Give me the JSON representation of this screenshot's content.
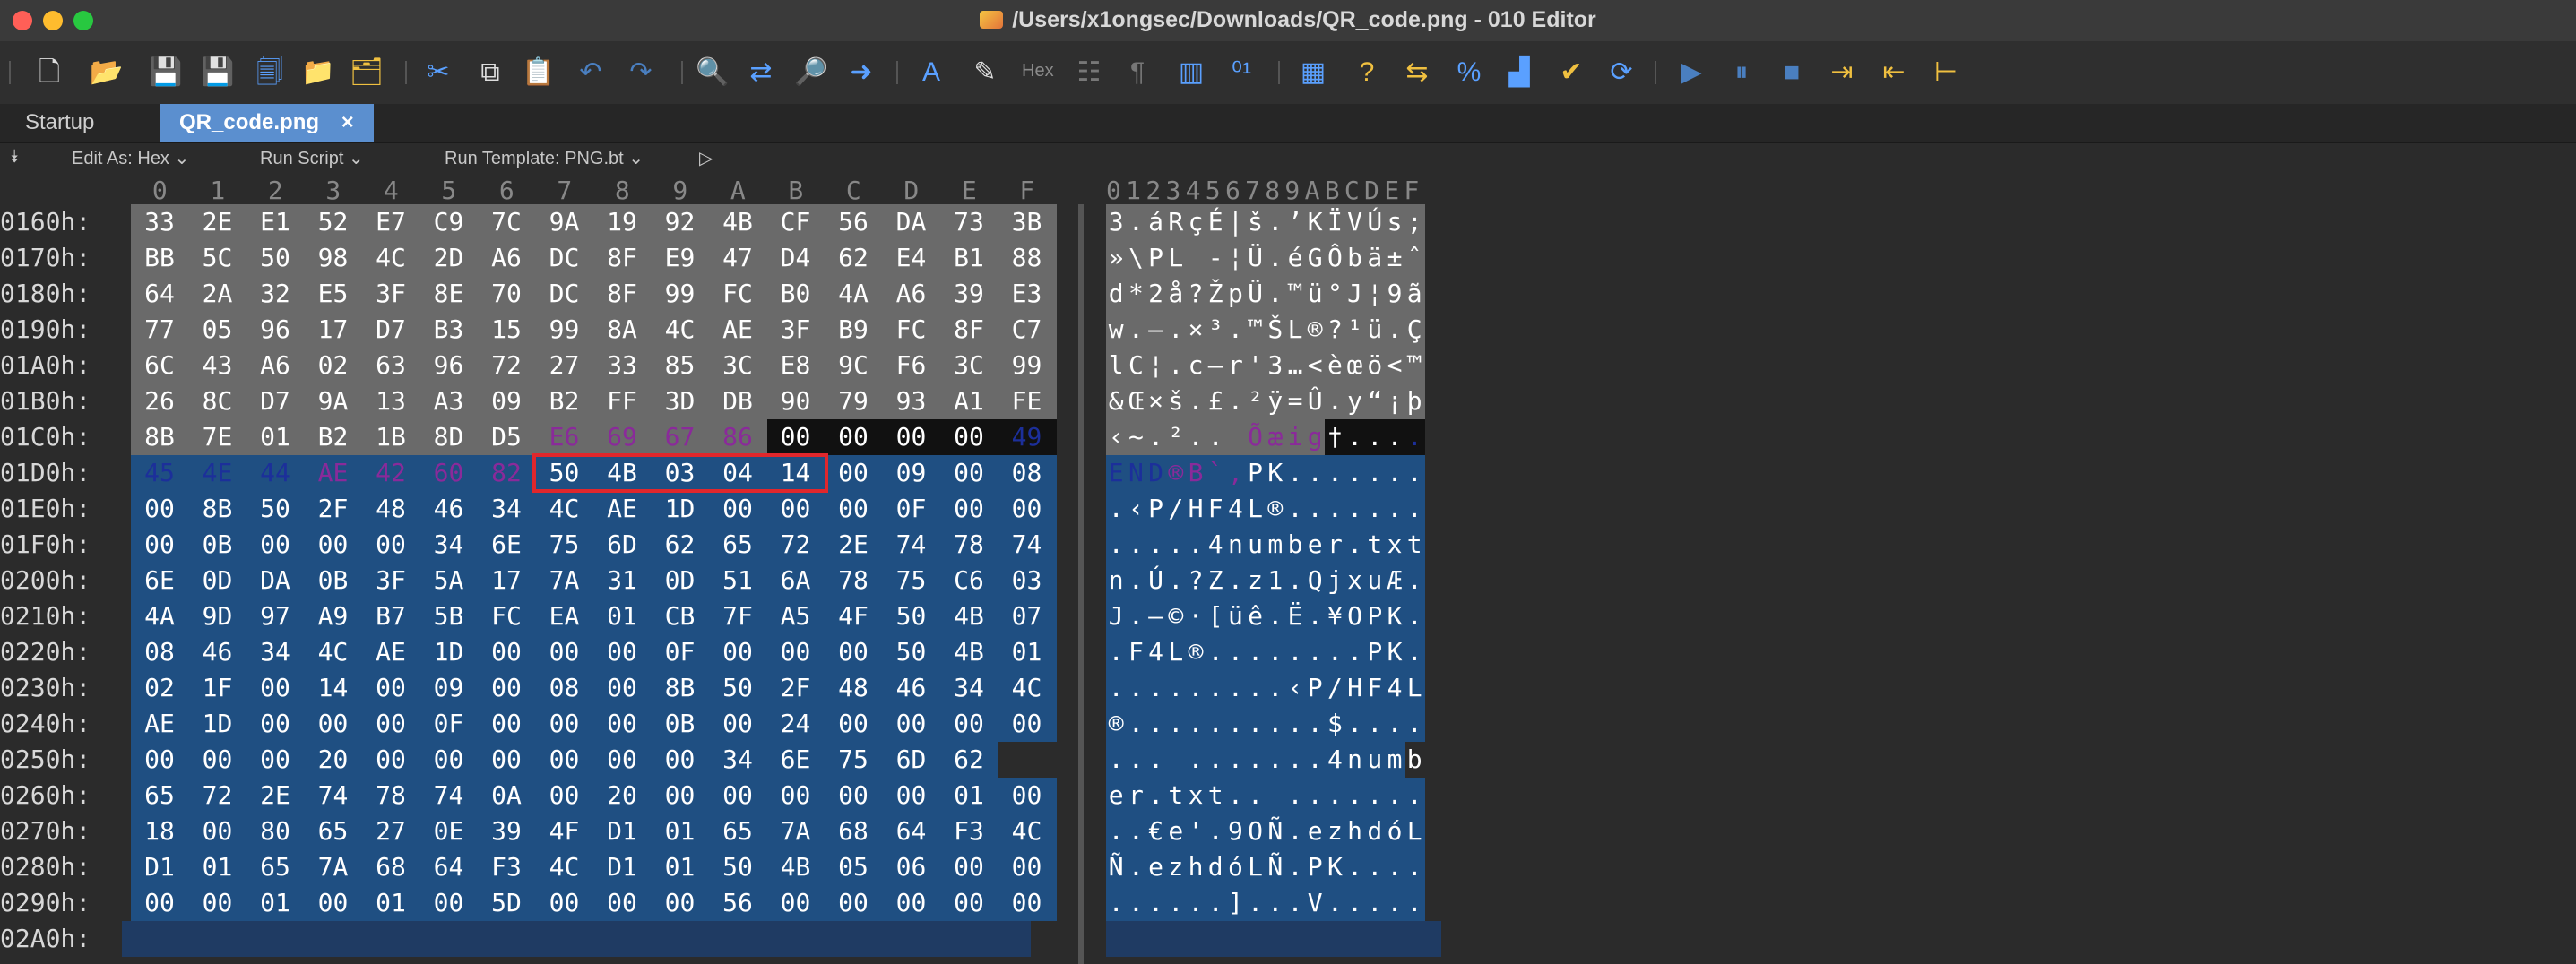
{
  "window": {
    "title": "/Users/x1ongsec/Downloads/QR_code.png - 010 Editor"
  },
  "toolbar": {
    "hex_label": "Hex",
    "icons": [
      "new-file-icon",
      "open-folder-icon",
      "save-icon",
      "save-all-icon",
      "save-copy-icon",
      "open-folder-2-icon",
      "open-workspace-icon",
      "cut-icon",
      "copy-icon",
      "paste-icon",
      "undo-icon",
      "redo-icon",
      "find-icon",
      "replace-icon",
      "find-in-files-icon",
      "goto-icon",
      "font-icon",
      "highlight-icon",
      "hex-mode-icon",
      "columns-icon",
      "pilcrow-icon",
      "grid-icon",
      "binary-icon",
      "calculator-icon",
      "inspector-icon",
      "swap-icon",
      "percent-icon",
      "chart-icon",
      "check-icon",
      "convert-icon",
      "run-icon",
      "pause-icon",
      "stop-icon",
      "indent-icon",
      "outdent-icon",
      "tree-icon"
    ]
  },
  "tabs": [
    {
      "label": "Startup"
    },
    {
      "label": "QR_code.png",
      "close": "×"
    }
  ],
  "editbar": {
    "edit_as": "Edit As: Hex",
    "run_script": "Run Script",
    "run_template": "Run Template: PNG.bt",
    "play": "▷"
  },
  "columns": [
    "0",
    "1",
    "2",
    "3",
    "4",
    "5",
    "6",
    "7",
    "8",
    "9",
    "A",
    "B",
    "C",
    "D",
    "E",
    "F"
  ],
  "ascii_header": "0123456789ABCDEF",
  "colors": {
    "selected_blue": "#1f4f82",
    "gray_region": "#6a6a6a",
    "purple_text": "#8a2a9a",
    "navy_text": "#1c2f9a",
    "black_region": "#111111",
    "red_highlight": "#e0272c"
  },
  "rows": [
    {
      "addr": "0160h:",
      "hex": [
        "33",
        "2E",
        "E1",
        "52",
        "E7",
        "C9",
        "7C",
        "9A",
        "19",
        "92",
        "4B",
        "CF",
        "56",
        "DA",
        "73",
        "3B"
      ],
      "ascii": "3.áRçÉ|š.’KÏVÚs;"
    },
    {
      "addr": "0170h:",
      "hex": [
        "BB",
        "5C",
        "50",
        "98",
        "4C",
        "2D",
        "A6",
        "DC",
        "8F",
        "E9",
        "47",
        "D4",
        "62",
        "E4",
        "B1",
        "88"
      ],
      "ascii": "»\\PL -¦Ü.éGÔbä±ˆ"
    },
    {
      "addr": "0180h:",
      "hex": [
        "64",
        "2A",
        "32",
        "E5",
        "3F",
        "8E",
        "70",
        "DC",
        "8F",
        "99",
        "FC",
        "B0",
        "4A",
        "A6",
        "39",
        "E3"
      ],
      "ascii": "d*2å?ŽpÜ.™ü°J¦9ã"
    },
    {
      "addr": "0190h:",
      "hex": [
        "77",
        "05",
        "96",
        "17",
        "D7",
        "B3",
        "15",
        "99",
        "8A",
        "4C",
        "AE",
        "3F",
        "B9",
        "FC",
        "8F",
        "C7"
      ],
      "ascii": "w.–.×³.™ŠL®?¹ü.Ç"
    },
    {
      "addr": "01A0h:",
      "hex": [
        "6C",
        "43",
        "A6",
        "02",
        "63",
        "96",
        "72",
        "27",
        "33",
        "85",
        "3C",
        "E8",
        "9C",
        "F6",
        "3C",
        "99"
      ],
      "ascii": "lC¦.c–r'3…<èœö<™"
    },
    {
      "addr": "01B0h:",
      "hex": [
        "26",
        "8C",
        "D7",
        "9A",
        "13",
        "A3",
        "09",
        "B2",
        "FF",
        "3D",
        "DB",
        "90",
        "79",
        "93",
        "A1",
        "FE"
      ],
      "ascii": "&Œ×š.£.²ÿ=Û.y“¡þ"
    },
    {
      "addr": "01C0h:",
      "hex": [
        "8B",
        "7E",
        "01",
        "B2",
        "1B",
        "8D",
        "D5",
        "E6",
        "69",
        "67",
        "86",
        "00",
        "00",
        "00",
        "00",
        "49"
      ],
      "ascii": "‹~.².. Õæig†....I"
    },
    {
      "addr": "01D0h:",
      "hex": [
        "45",
        "4E",
        "44",
        "AE",
        "42",
        "60",
        "82",
        "50",
        "4B",
        "03",
        "04",
        "14",
        "00",
        "09",
        "00",
        "08"
      ],
      "ascii": "END®B`‚PK......."
    },
    {
      "addr": "01E0h:",
      "hex": [
        "00",
        "8B",
        "50",
        "2F",
        "48",
        "46",
        "34",
        "4C",
        "AE",
        "1D",
        "00",
        "00",
        "00",
        "0F",
        "00",
        "00"
      ],
      "ascii": ".‹P/HF4L®......."
    },
    {
      "addr": "01F0h:",
      "hex": [
        "00",
        "0B",
        "00",
        "00",
        "00",
        "34",
        "6E",
        "75",
        "6D",
        "62",
        "65",
        "72",
        "2E",
        "74",
        "78",
        "74"
      ],
      "ascii": ".....4number.txt"
    },
    {
      "addr": "0200h:",
      "hex": [
        "6E",
        "0D",
        "DA",
        "0B",
        "3F",
        "5A",
        "17",
        "7A",
        "31",
        "0D",
        "51",
        "6A",
        "78",
        "75",
        "C6",
        "03"
      ],
      "ascii": "n.Ú.?Z.z1.QjxuÆ."
    },
    {
      "addr": "0210h:",
      "hex": [
        "4A",
        "9D",
        "97",
        "A9",
        "B7",
        "5B",
        "FC",
        "EA",
        "01",
        "CB",
        "7F",
        "A5",
        "4F",
        "50",
        "4B",
        "07"
      ],
      "ascii": "J.—©·[üê.Ë.¥OPK."
    },
    {
      "addr": "0220h:",
      "hex": [
        "08",
        "46",
        "34",
        "4C",
        "AE",
        "1D",
        "00",
        "00",
        "00",
        "0F",
        "00",
        "00",
        "00",
        "50",
        "4B",
        "01"
      ],
      "ascii": ".F4L®........PK."
    },
    {
      "addr": "0230h:",
      "hex": [
        "02",
        "1F",
        "00",
        "14",
        "00",
        "09",
        "00",
        "08",
        "00",
        "8B",
        "50",
        "2F",
        "48",
        "46",
        "34",
        "4C"
      ],
      "ascii": ".........‹P/HF4L"
    },
    {
      "addr": "0240h:",
      "hex": [
        "AE",
        "1D",
        "00",
        "00",
        "00",
        "0F",
        "00",
        "00",
        "00",
        "0B",
        "00",
        "24",
        "00",
        "00",
        "00",
        "00"
      ],
      "ascii": "®..........$...."
    },
    {
      "addr": "0250h:",
      "hex": [
        "00",
        "00",
        "00",
        "20",
        "00",
        "00",
        "00",
        "00",
        "00",
        "00",
        "34",
        "6E",
        "75",
        "6D",
        "62"
      ],
      "ascii": "... .......4numb"
    },
    {
      "addr": "0260h:",
      "hex": [
        "65",
        "72",
        "2E",
        "74",
        "78",
        "74",
        "0A",
        "00",
        "20",
        "00",
        "00",
        "00",
        "00",
        "00",
        "01",
        "00"
      ],
      "ascii": "er.txt.. ......."
    },
    {
      "addr": "0270h:",
      "hex": [
        "18",
        "00",
        "80",
        "65",
        "27",
        "0E",
        "39",
        "4F",
        "D1",
        "01",
        "65",
        "7A",
        "68",
        "64",
        "F3",
        "4C"
      ],
      "ascii": "..€e'.9OÑ.ezhdóL"
    },
    {
      "addr": "0280h:",
      "hex": [
        "D1",
        "01",
        "65",
        "7A",
        "68",
        "64",
        "F3",
        "4C",
        "D1",
        "01",
        "50",
        "4B",
        "05",
        "06",
        "00",
        "00"
      ],
      "ascii": "Ñ.ezhdóLÑ.PK...."
    },
    {
      "addr": "0290h:",
      "hex": [
        "00",
        "00",
        "01",
        "00",
        "01",
        "00",
        "5D",
        "00",
        "00",
        "00",
        "56",
        "00",
        "00",
        "00",
        "00",
        "00"
      ],
      "ascii": "......]...V....."
    },
    {
      "addr": "02A0h:",
      "hex": [],
      "ascii": ""
    }
  ]
}
